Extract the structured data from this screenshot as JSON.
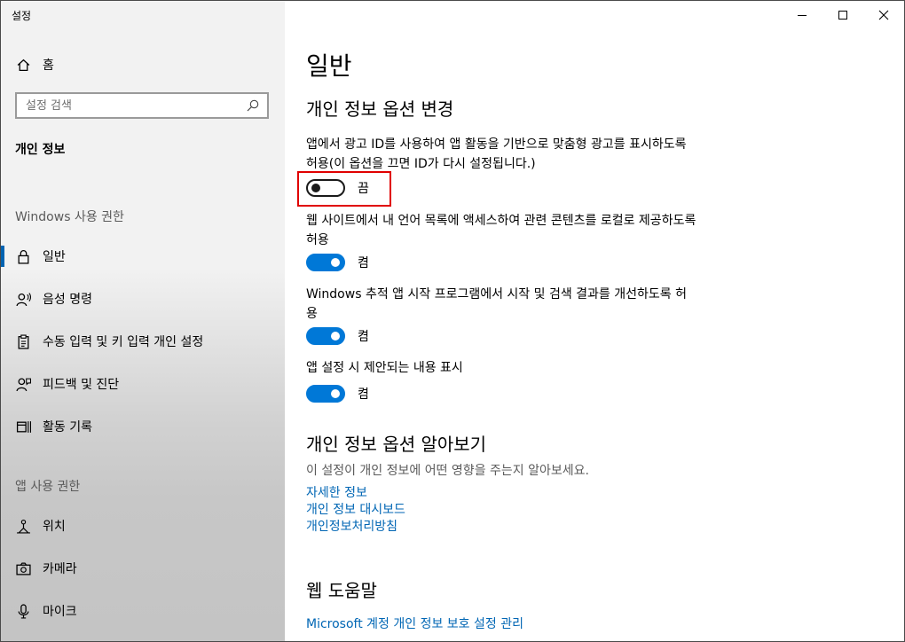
{
  "window": {
    "title": "설정"
  },
  "sidebar": {
    "home_label": "홈",
    "search_placeholder": "설정 검색",
    "section_title": "개인 정보",
    "group_windows": "Windows 사용 권한",
    "windows_items": [
      {
        "label": "일반",
        "icon": "lock-icon",
        "selected": true
      },
      {
        "label": "음성 명령",
        "icon": "voice-icon",
        "selected": false
      },
      {
        "label": "수동 입력 및 키 입력 개인 설정",
        "icon": "clipboard-icon",
        "selected": false
      },
      {
        "label": "피드백 및 진단",
        "icon": "feedback-icon",
        "selected": false
      },
      {
        "label": "활동 기록",
        "icon": "activity-history-icon",
        "selected": false
      }
    ],
    "group_apps": "앱 사용 권한",
    "app_items": [
      {
        "label": "위치",
        "icon": "location-icon"
      },
      {
        "label": "카메라",
        "icon": "camera-icon"
      },
      {
        "label": "마이크",
        "icon": "microphone-icon"
      }
    ]
  },
  "main": {
    "page_title": "일반",
    "section_change": "개인 정보 옵션 변경",
    "settings": [
      {
        "desc": "앱에서 광고 ID를 사용하여 앱 활동을 기반으로 맞춤형 광고를 표시하도록 허용(이 옵션을 끄면 ID가 다시 설정됩니다.)",
        "on": false,
        "state": "끔"
      },
      {
        "desc": "웹 사이트에서 내 언어 목록에 액세스하여 관련 콘텐츠를 로컬로 제공하도록 허용",
        "on": true,
        "state": "켬"
      },
      {
        "desc": "Windows 추적 앱 시작 프로그램에서 시작 및 검색 결과를 개선하도록 허용",
        "on": true,
        "state": "켬"
      },
      {
        "desc": "앱 설정 시 제안되는 내용 표시",
        "on": true,
        "state": "켬"
      }
    ],
    "section_learn": "개인 정보 옵션 알아보기",
    "learn_desc": "이 설정이 개인 정보에 어떤 영향을 주는지 알아보세요.",
    "links": [
      "자세한 정보",
      "개인 정보 대시보드",
      "개인정보처리방침"
    ],
    "section_help": "웹 도움말",
    "help_link": "Microsoft 계정 개인 정보 보호 설정 관리"
  },
  "colors": {
    "accent": "#0078d7",
    "link": "#0066b4",
    "highlight": "#e00000"
  }
}
